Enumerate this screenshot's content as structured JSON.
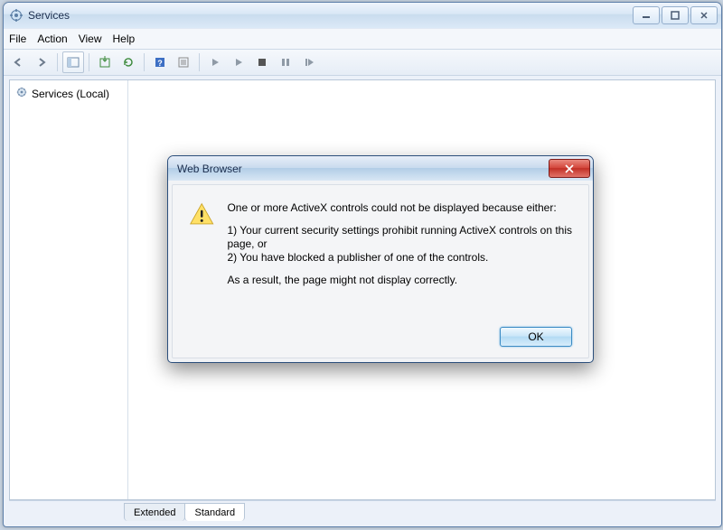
{
  "window": {
    "title": "Services"
  },
  "menu": {
    "file": "File",
    "action": "Action",
    "view": "View",
    "help": "Help"
  },
  "tree": {
    "root": "Services (Local)"
  },
  "tabs": {
    "extended": "Extended",
    "standard": "Standard"
  },
  "dialog": {
    "title": "Web Browser",
    "line1": "One or more ActiveX controls could not be displayed because either:",
    "line2": "1) Your current security settings prohibit running ActiveX controls on this page, or",
    "line3": "2) You have blocked a publisher of one of the controls.",
    "line4": "As a result, the page might not display correctly.",
    "ok": "OK"
  }
}
